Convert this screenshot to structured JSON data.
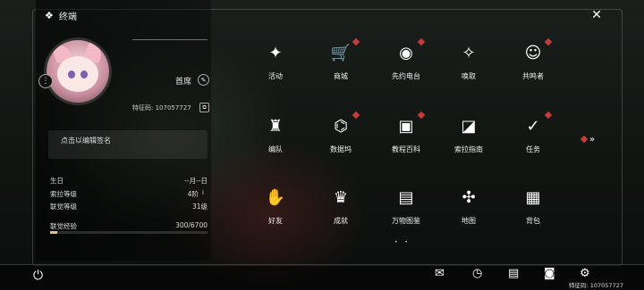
{
  "header": {
    "title": "终端"
  },
  "profile": {
    "name": "首席",
    "uid_label": "特征码: 107057727",
    "signature_placeholder": "点击以编辑签名",
    "stats": [
      {
        "label": "生日",
        "value": "--月--日"
      },
      {
        "label": "索拉等级",
        "value": "4阶"
      },
      {
        "label": "联觉等级",
        "value": "31级"
      }
    ],
    "exp_label": "联觉经验",
    "exp_value": "300/6700",
    "exp_fraction": 0.045
  },
  "menu": [
    {
      "label": "活动",
      "icon": "activity-icon",
      "glyph": "✦",
      "badge": false
    },
    {
      "label": "商城",
      "icon": "shop-cart-icon",
      "glyph": "🛒",
      "badge": true
    },
    {
      "label": "先约电台",
      "icon": "radio-icon",
      "glyph": "◉",
      "badge": true
    },
    {
      "label": "唤取",
      "icon": "summon-icon",
      "glyph": "✧",
      "badge": false
    },
    {
      "label": "共鸣者",
      "icon": "resonator-icon",
      "glyph": "☺",
      "badge": true
    },
    {
      "label": "编队",
      "icon": "team-icon",
      "glyph": "♜",
      "badge": false
    },
    {
      "label": "数据坞",
      "icon": "data-dock-icon",
      "glyph": "⌬",
      "badge": true
    },
    {
      "label": "教程百科",
      "icon": "tutorial-book-icon",
      "glyph": "▣",
      "badge": true
    },
    {
      "label": "索拉指南",
      "icon": "guide-book-icon",
      "glyph": "◪",
      "badge": false
    },
    {
      "label": "任务",
      "icon": "quest-icon",
      "glyph": "✓",
      "badge": true
    },
    {
      "label": "好友",
      "icon": "friends-handshake-icon",
      "glyph": "✋",
      "badge": false
    },
    {
      "label": "成就",
      "icon": "achievement-trophy-icon",
      "glyph": "♛",
      "badge": false
    },
    {
      "label": "万物图鉴",
      "icon": "codex-cards-icon",
      "glyph": "▤",
      "badge": false
    },
    {
      "label": "地图",
      "icon": "map-compass-icon",
      "glyph": "✣",
      "badge": false
    },
    {
      "label": "背包",
      "icon": "backpack-icon",
      "glyph": "▦",
      "badge": false
    }
  ],
  "bottom": {
    "uid_label": "特征码: 107057727",
    "icons": [
      "mail-icon",
      "clock-icon",
      "notice-icon",
      "camera-icon",
      "settings-gear-icon"
    ]
  }
}
